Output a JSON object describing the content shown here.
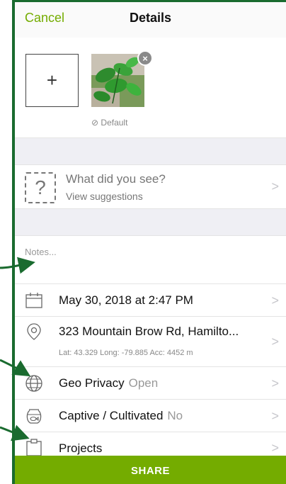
{
  "nav": {
    "cancel": "Cancel",
    "title": "Details"
  },
  "photos": {
    "add_label": "+",
    "remove_label": "×",
    "default_label": "Default"
  },
  "species": {
    "title": "What did you see?",
    "subtitle": "View suggestions",
    "icon": "?"
  },
  "notes": {
    "placeholder": "Notes..."
  },
  "date_row": {
    "label": "May 30, 2018 at 2:47 PM"
  },
  "location_row": {
    "label": "323 Mountain Brow Rd, Hamilto...",
    "coords": "Lat: 43.329  Long: -79.885  Acc: 4452 m"
  },
  "geo_row": {
    "label": "Geo Privacy",
    "value": "Open"
  },
  "captive_row": {
    "label": "Captive / Cultivated",
    "value": "No"
  },
  "projects_row": {
    "label": "Projects"
  },
  "chevron": ">",
  "share": {
    "label": "SHARE"
  },
  "colors": {
    "accent": "#74ac00",
    "frame": "#1a6b2f",
    "annotation": "#1a6b2f"
  }
}
